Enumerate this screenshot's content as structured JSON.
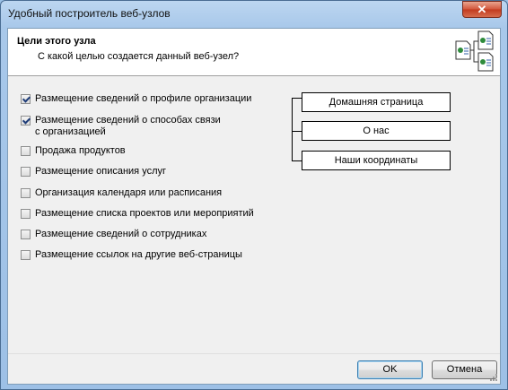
{
  "window": {
    "title": "Удобный построитель веб-узлов",
    "close_glyph": "✕"
  },
  "header": {
    "title": "Цели этого узла",
    "subtitle": "С какой целью создается данный веб-узел?"
  },
  "options": [
    {
      "label": "Размещение сведений о профиле организации",
      "checked": true
    },
    {
      "label": "Размещение сведений о способах связи с организацией",
      "checked": true
    },
    {
      "label": "Продажа продуктов",
      "checked": false
    },
    {
      "label": "Размещение описания услуг",
      "checked": false
    },
    {
      "label": "Организация календаря или расписания",
      "checked": false
    },
    {
      "label": "Размещение списка проектов или мероприятий",
      "checked": false
    },
    {
      "label": "Размещение сведений о сотрудниках",
      "checked": false
    },
    {
      "label": "Размещение ссылок на другие веб-страницы",
      "checked": false
    }
  ],
  "pages": [
    "Домашняя страница",
    "О нас",
    "Наши координаты"
  ],
  "buttons": {
    "ok": "OK",
    "cancel": "Отмена"
  },
  "icons": {
    "wizard": "web-pages-icon",
    "close": "close-icon"
  }
}
